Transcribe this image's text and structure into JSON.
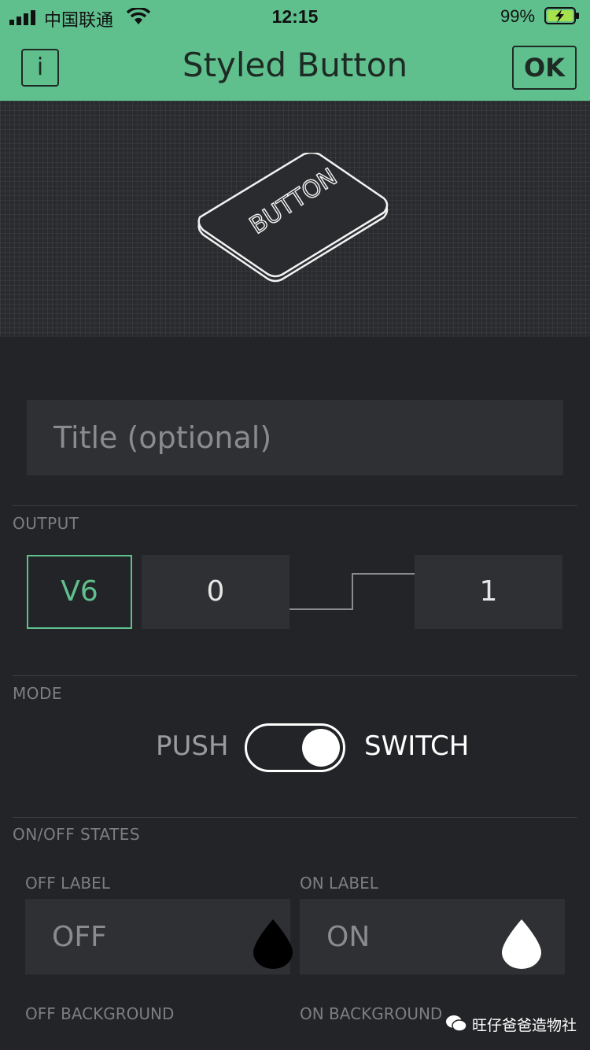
{
  "status_bar": {
    "carrier": "中国联通",
    "time": "12:15",
    "battery": "99%"
  },
  "nav": {
    "title": "Styled Button",
    "info_label": "i",
    "ok_label": "OK"
  },
  "preview": {
    "button_caption": "BUTTON"
  },
  "title_field": {
    "placeholder": "Title (optional)"
  },
  "output": {
    "section_label": "OUTPUT",
    "pin": "V6",
    "off_value": "0",
    "on_value": "1"
  },
  "mode": {
    "section_label": "MODE",
    "left_label": "PUSH",
    "right_label": "SWITCH",
    "selected": "SWITCH"
  },
  "states": {
    "section_label": "ON/OFF STATES",
    "off_label_caption": "OFF LABEL",
    "on_label_caption": "ON LABEL",
    "off_label_value": "OFF",
    "on_label_value": "ON",
    "off_background_caption": "OFF BACKGROUND",
    "on_background_caption": "ON BACKGROUND",
    "off_color": "#000000",
    "on_color": "#ffffff"
  },
  "watermark": {
    "text": "旺仔爸爸造物社"
  },
  "colors": {
    "accent": "#5fc08e",
    "background": "#232427",
    "field": "#2f3033"
  }
}
